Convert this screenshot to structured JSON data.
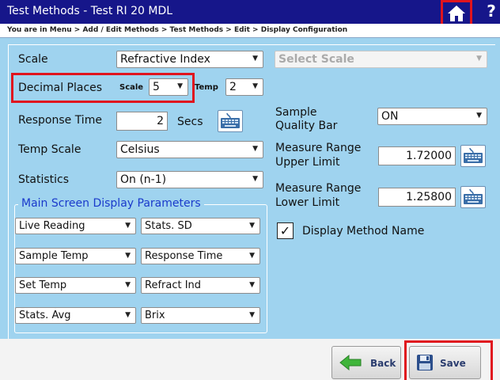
{
  "titlebar": {
    "title": "Test Methods - Test RI 20 MDL",
    "help": "?"
  },
  "breadcrumb": "You are in Menu > Add / Edit Methods > Test Methods > Edit > Display Configuration",
  "left": {
    "scale_label": "Scale",
    "scale_value": "Refractive Index",
    "decimal_label": "Decimal Places",
    "decimal_scale_label": "Scale",
    "decimal_scale_value": "5",
    "decimal_temp_label": "Temp",
    "decimal_temp_value": "2",
    "response_label": "Response Time",
    "response_value": "2",
    "response_unit": "Secs",
    "temp_scale_label": "Temp Scale",
    "temp_scale_value": "Celsius",
    "statistics_label": "Statistics",
    "statistics_value": "On (n-1)"
  },
  "right": {
    "select_scale_placeholder": "Select Scale",
    "quality_label_1": "Sample",
    "quality_label_2": "Quality Bar",
    "quality_value": "ON",
    "upper_label_1": "Measure Range",
    "upper_label_2": "Upper Limit",
    "upper_value": "1.72000",
    "lower_label_1": "Measure Range",
    "lower_label_2": "Lower Limit",
    "lower_value": "1.25800",
    "display_name_check": "✓",
    "display_name_label": "Display Method Name"
  },
  "main_params": {
    "title": "Main Screen Display Parameters",
    "slots": [
      "Live Reading",
      "Stats. SD",
      "Sample Temp",
      "Response Time",
      "Set Temp",
      "Refract Ind",
      "Stats. Avg",
      "Brix"
    ]
  },
  "footer": {
    "back_label": "Back",
    "save_label": "Save"
  },
  "colors": {
    "titlebar": "#16168a",
    "panel": "#9fd3ef",
    "highlight": "#e0141e",
    "group_title": "#1a3acb"
  },
  "icons": {
    "dropdown": "▼",
    "home": "home-icon",
    "keyboard": "keyboard-icon",
    "back": "arrow-left-icon",
    "save": "floppy-disk-icon"
  }
}
